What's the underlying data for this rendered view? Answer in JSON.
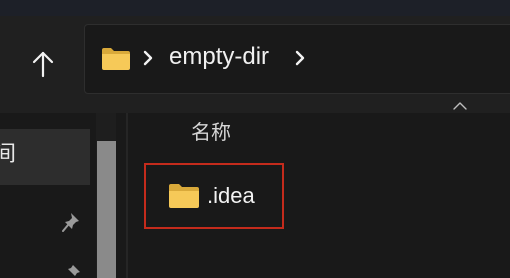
{
  "toolbar": {
    "up_button_icon": "arrow-up-icon"
  },
  "address_bar": {
    "folder_icon": "folder-icon",
    "separator_icon": "chevron-right-icon",
    "path_segment": "empty-dir"
  },
  "nav_pane": {
    "selected_item_text": "间",
    "pin_icon": "pin-icon"
  },
  "content": {
    "sort_indicator_icon": "chevron-up-icon",
    "column_header_name": "名称",
    "items": [
      {
        "name": ".idea",
        "icon": "folder-icon"
      }
    ]
  },
  "colors": {
    "window_bg": "#191919",
    "toolbar_bg": "#202020",
    "folder_yellow": "#f4c74f",
    "selection_outline": "#c42b1c",
    "text": "#f0f0f0"
  }
}
